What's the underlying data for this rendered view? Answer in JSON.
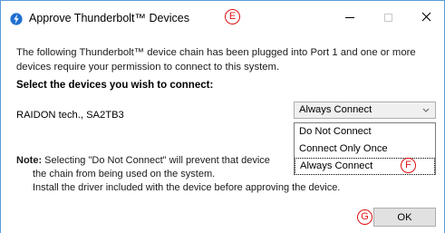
{
  "window": {
    "title": "Approve Thunderbolt™ Devices"
  },
  "markers": {
    "e": "E",
    "f": "F",
    "g": "G"
  },
  "content": {
    "intro": "The following Thunderbolt™ device chain has been plugged into Port 1 and one or more devices require your permission to connect to this system.",
    "select_heading": "Select the devices you wish to connect:",
    "device_name": "RAIDON tech., SA2TB3",
    "note_label": "Note:",
    "note_line1": "Selecting \"Do Not Connect\" will prevent that device",
    "note_line2": "the chain from being used on the system.",
    "note_line3": "Install the driver included with the device before approving the device."
  },
  "dropdown": {
    "selected": "Always Connect",
    "options": [
      "Do Not Connect",
      "Connect Only Once",
      "Always Connect"
    ]
  },
  "buttons": {
    "ok": "OK"
  },
  "icons": {
    "app": "thunderbolt-icon",
    "minimize": "minimize-icon",
    "maximize": "maximize-icon",
    "close": "close-icon",
    "dropdown": "chevron-down-icon"
  },
  "colors": {
    "thunderbolt_blue": "#1f6fd0",
    "marker_red": "#e01010",
    "window_border": "#5a9ad8"
  }
}
